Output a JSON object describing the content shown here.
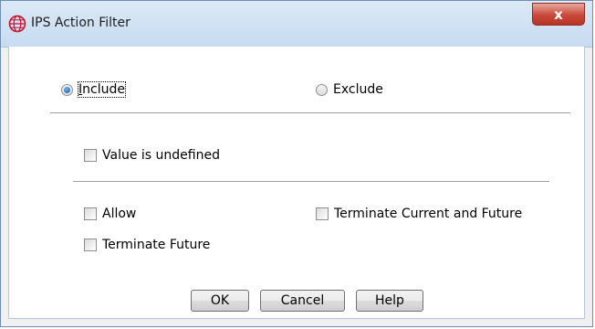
{
  "window": {
    "title": "IPS Action Filter",
    "close_glyph": "x",
    "icon": "filter-globe-icon"
  },
  "mode": {
    "include_label": "Include",
    "exclude_label": "Exclude",
    "selected": "Include"
  },
  "checkboxes": {
    "value_undefined": "Value is undefined",
    "allow": "Allow",
    "terminate_current_future": "Terminate Current and Future",
    "terminate_future": "Terminate Future"
  },
  "buttons": {
    "ok": "OK",
    "cancel": "Cancel",
    "help": "Help"
  },
  "colors": {
    "accent": "#0a5ba8",
    "close": "#c9493a",
    "brand_icon": "#c8102e"
  }
}
